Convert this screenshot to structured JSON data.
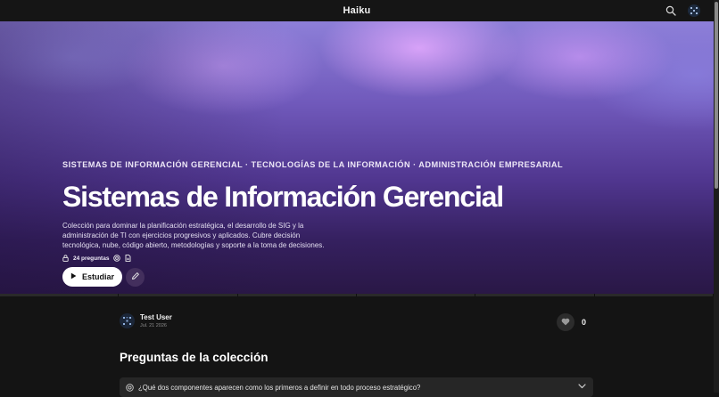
{
  "app": {
    "title": "Haiku"
  },
  "header": {
    "search_icon": "search-icon",
    "avatar_icon": "avatar-icon"
  },
  "hero": {
    "categories": "SISTEMAS DE INFORMACIÓN GERENCIAL · TECNOLOGÍAS DE LA INFORMACIÓN · ADMINISTRACIÓN EMPRESARIAL",
    "title": "Sistemas de Información Gerencial",
    "description": "Colección para dominar la planificación estratégica, el desarrollo de SIG y la administración de TI con ejercicios progresivos y aplicados. Cubre decisión tecnológica, nube, código abierto, metodologías y soporte a la toma de decisiones.",
    "question_count": "24 preguntas",
    "study_label": "Estudiar",
    "colors": {
      "gradient_top": "#8d7fd8",
      "gradient_bottom": "#291745",
      "highlight": "#e6aaff"
    }
  },
  "author": {
    "name": "Test User",
    "date": "Jul. 21 2026"
  },
  "likes": {
    "count": "0"
  },
  "section": {
    "title": "Preguntas de la colección"
  },
  "questions": [
    {
      "text": "¿Qué dos componentes aparecen como los primeros a definir en todo proceso estratégico?"
    }
  ]
}
